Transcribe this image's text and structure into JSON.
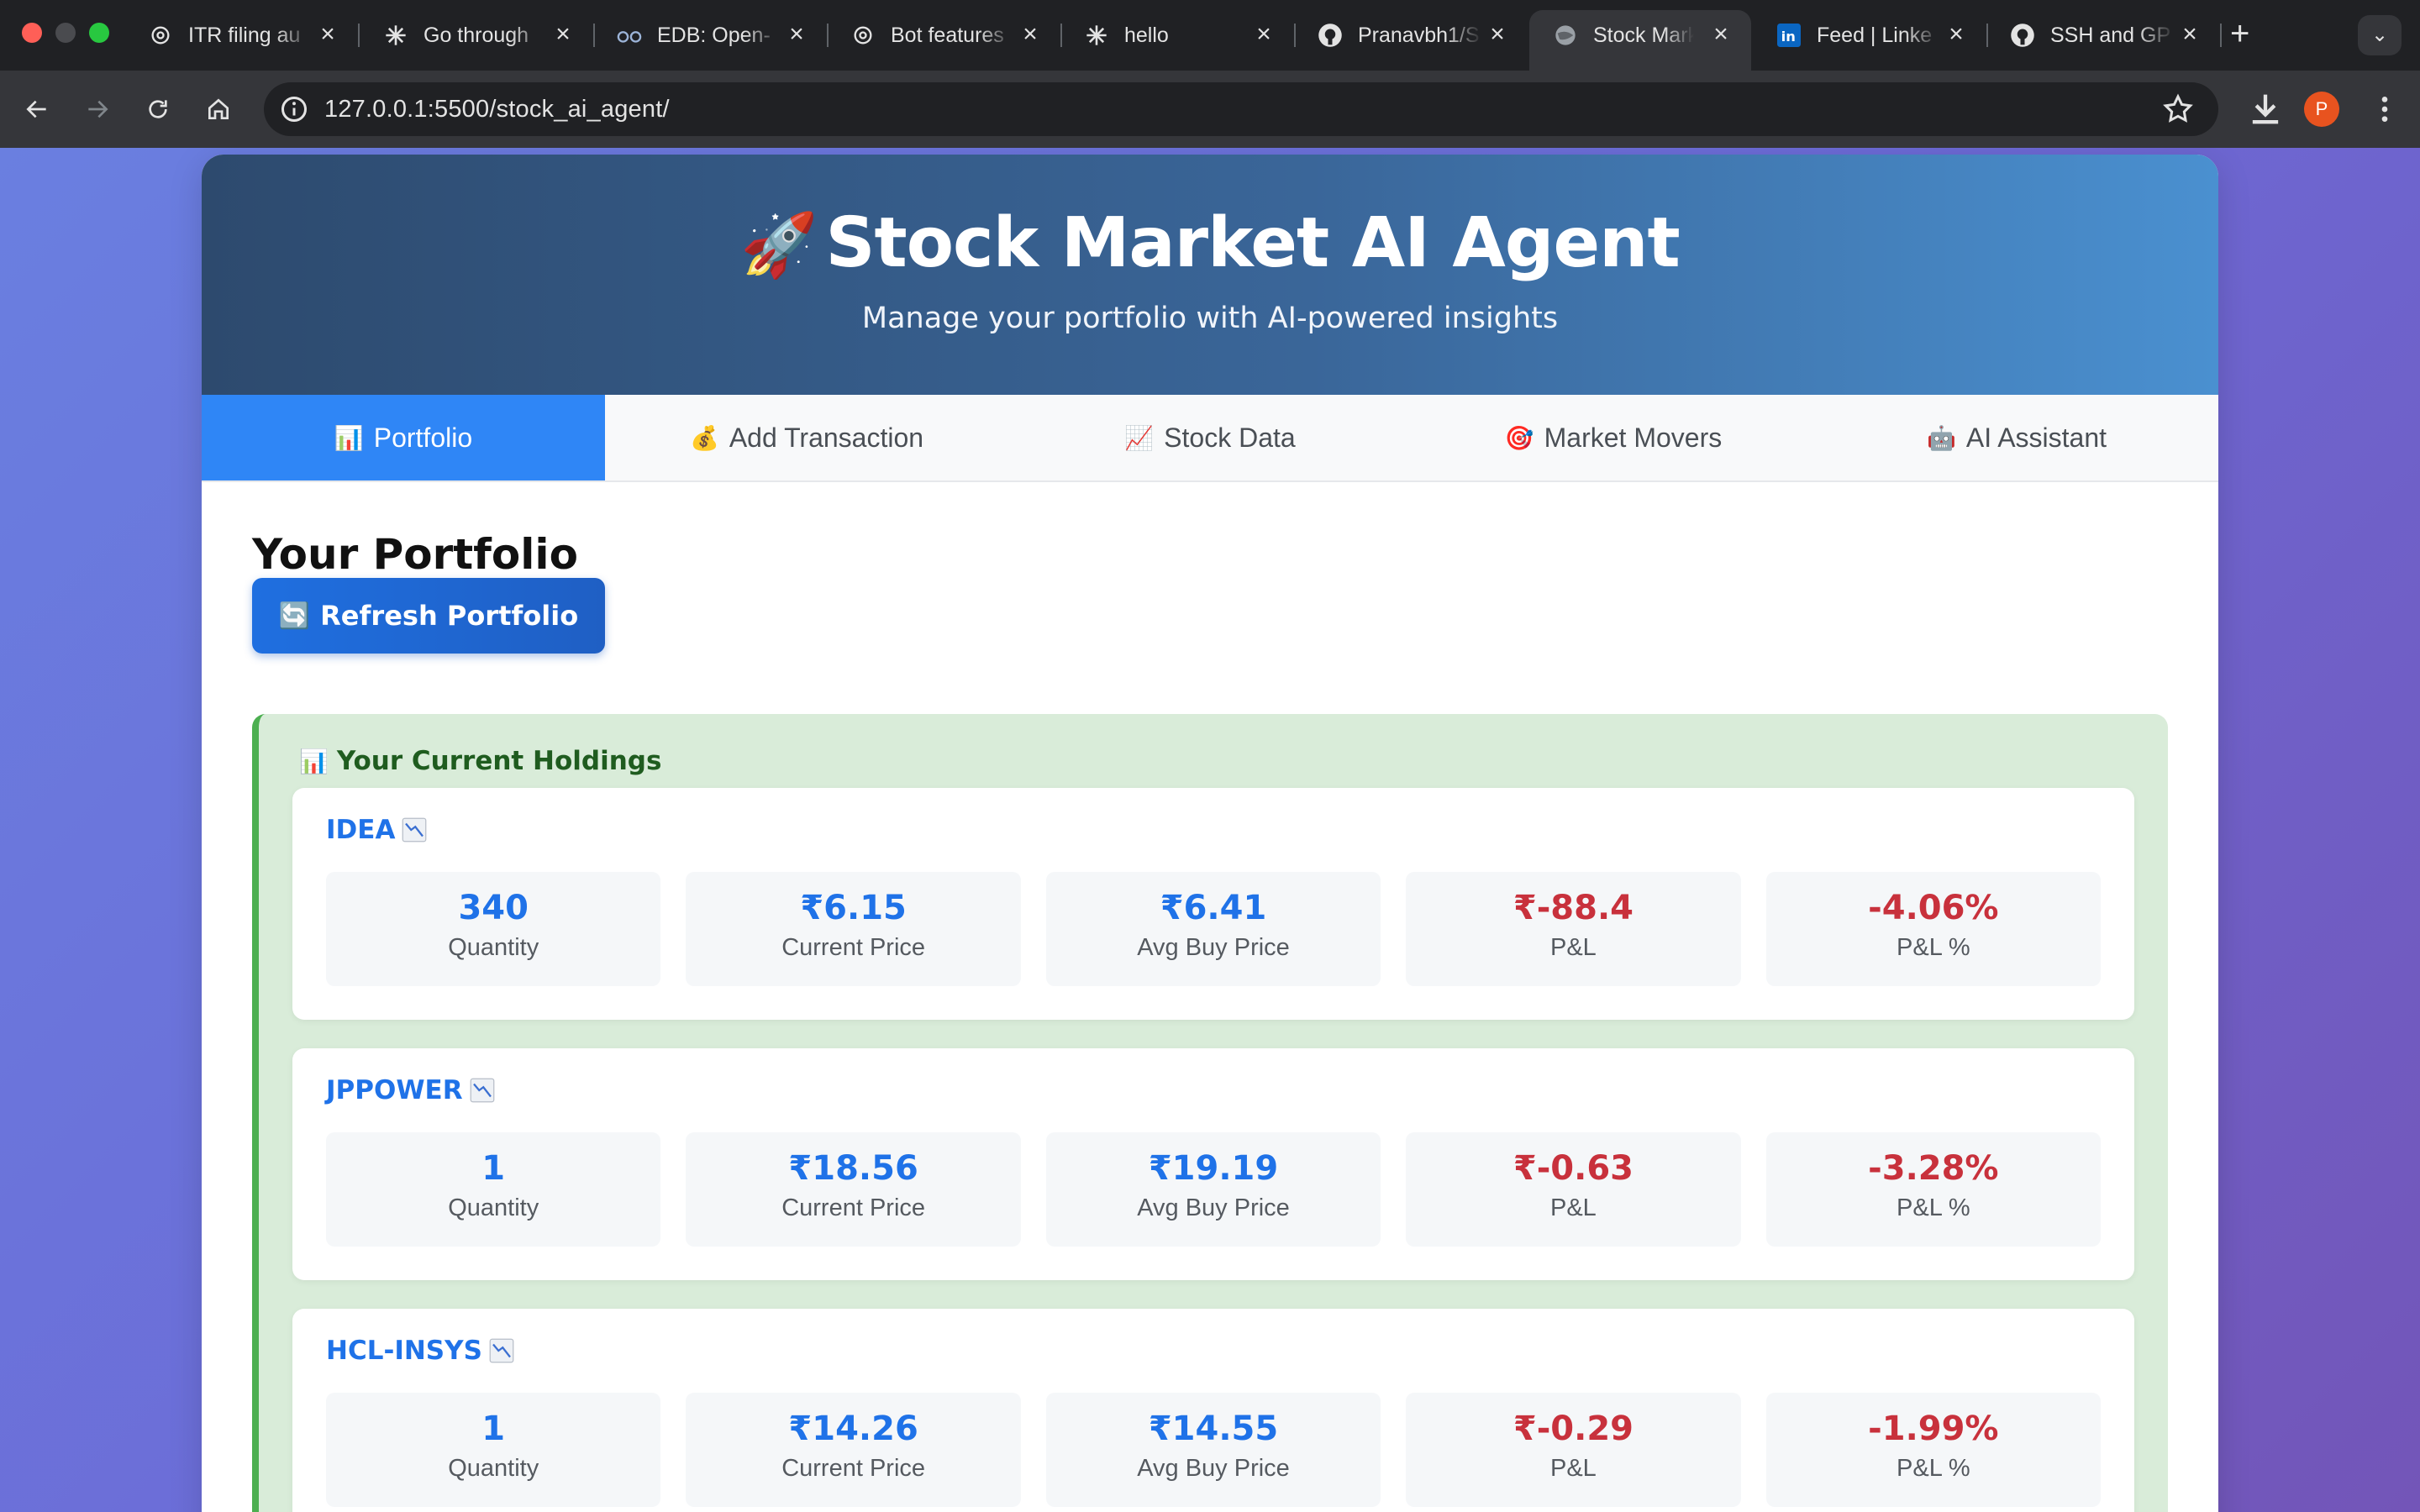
{
  "browser": {
    "tabs": [
      {
        "title": "ITR filing au",
        "icon": "openai-icon"
      },
      {
        "title": "Go through",
        "icon": "claude-icon"
      },
      {
        "title": "EDB: Open-",
        "icon": "edb-icon"
      },
      {
        "title": "Bot features",
        "icon": "openai-icon"
      },
      {
        "title": "hello",
        "icon": "claude-icon"
      },
      {
        "title": "Pranavbh1/S",
        "icon": "github-icon"
      },
      {
        "title": "Stock Marke",
        "icon": "globe-icon",
        "active": true
      },
      {
        "title": "Feed | Linke",
        "icon": "linkedin-icon"
      },
      {
        "title": "SSH and GP",
        "icon": "github-icon"
      }
    ],
    "url": "127.0.0.1:5500/stock_ai_agent/",
    "profile_initial": "P"
  },
  "header": {
    "icon": "🚀",
    "title": "Stock Market AI Agent",
    "subtitle": "Manage your portfolio with AI-powered insights"
  },
  "nav": {
    "tabs": [
      {
        "icon": "📊",
        "label": "Portfolio",
        "active": true
      },
      {
        "icon": "💰",
        "label": "Add Transaction"
      },
      {
        "icon": "📈",
        "label": "Stock Data"
      },
      {
        "icon": "🎯",
        "label": "Market Movers"
      },
      {
        "icon": "🤖",
        "label": "AI Assistant"
      }
    ]
  },
  "portfolio": {
    "heading": "Your Portfolio",
    "refresh_icon": "🔄",
    "refresh_label": "Refresh Portfolio",
    "holdings_icon": "📊",
    "holdings_title": "Your Current Holdings",
    "labels": {
      "quantity": "Quantity",
      "current_price": "Current Price",
      "avg_buy_price": "Avg Buy Price",
      "pnl": "P&L",
      "pnl_pct": "P&L %"
    },
    "stocks": [
      {
        "symbol": "IDEA",
        "trend": "down-trend-icon",
        "quantity": "340",
        "current_price": "₹6.15",
        "avg_buy_price": "₹6.41",
        "pnl": "₹-88.4",
        "pnl_pct": "-4.06%"
      },
      {
        "symbol": "JPPOWER",
        "trend": "down-trend-icon",
        "quantity": "1",
        "current_price": "₹18.56",
        "avg_buy_price": "₹19.19",
        "pnl": "₹-0.63",
        "pnl_pct": "-3.28%"
      },
      {
        "symbol": "HCL-INSYS",
        "trend": "down-trend-icon",
        "quantity": "1",
        "current_price": "₹14.26",
        "avg_buy_price": "₹14.55",
        "pnl": "₹-0.29",
        "pnl_pct": "-1.99%"
      }
    ]
  },
  "colors": {
    "accent": "#2f86f6",
    "positive_value": "#1f72e8",
    "negative_value": "#c8313c",
    "holdings_bg": "#d9ecd9",
    "holdings_border": "#4caf50"
  }
}
